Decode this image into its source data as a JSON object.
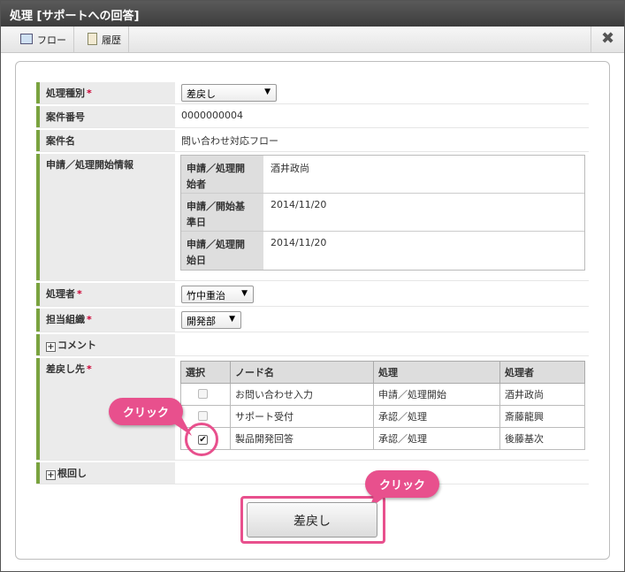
{
  "window": {
    "title": "処理 [サポートへの回答]"
  },
  "toolbar": {
    "flow_label": "フロー",
    "history_label": "履歴",
    "close_glyph": "✖"
  },
  "form": {
    "process_type": {
      "label": "処理種別",
      "required": "*",
      "value": "差戻し"
    },
    "case_number": {
      "label": "案件番号",
      "value": "0000000004"
    },
    "case_name": {
      "label": "案件名",
      "value": "問い合わせ対応フロー"
    },
    "apply_info": {
      "label": "申請／処理開始情報",
      "rows": [
        {
          "label_line1": "申請／処理開",
          "label_line2": "始者",
          "value": "酒井政尚"
        },
        {
          "label_line1": "申請／開始基",
          "label_line2": "準日",
          "value": "2014/11/20"
        },
        {
          "label_line1": "申請／処理開",
          "label_line2": "始日",
          "value": "2014/11/20"
        }
      ]
    },
    "processor": {
      "label": "処理者",
      "required": "*",
      "value": "竹中重治"
    },
    "organization": {
      "label": "担当組織",
      "required": "*",
      "value": "開発部"
    },
    "comment": {
      "label": "コメント"
    },
    "return_to": {
      "label": "差戻し先",
      "required": "*",
      "headers": [
        "選択",
        "ノード名",
        "処理",
        "処理者"
      ],
      "rows": [
        {
          "checked": false,
          "node": "お問い合わせ入力",
          "action": "申請／処理開始",
          "person": "酒井政尚"
        },
        {
          "checked": false,
          "node": "サポート受付",
          "action": "承認／処理",
          "person": "斎藤龍興"
        },
        {
          "checked": true,
          "node": "製品開発回答",
          "action": "承認／処理",
          "person": "後藤基次"
        }
      ]
    },
    "nemawashi": {
      "label": "根回し"
    }
  },
  "annotations": {
    "click_label_1": "クリック",
    "click_label_2": "クリック",
    "accent_color": "#e8508d"
  },
  "actions": {
    "submit_label": "差戻し"
  }
}
